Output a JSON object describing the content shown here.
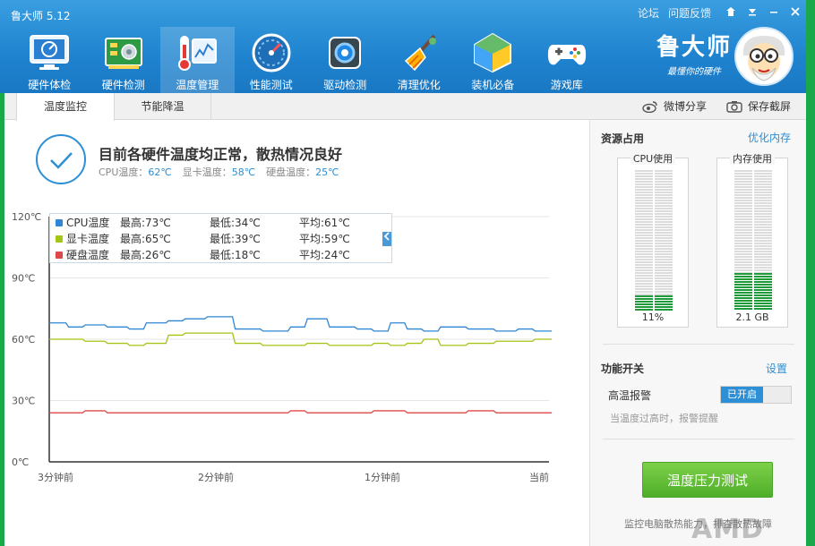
{
  "app": {
    "title": "鲁大师 5.12"
  },
  "window_controls": {
    "forum": "论坛",
    "feedback": "问题反馈"
  },
  "nav": [
    {
      "label": "硬件体检",
      "icon": "monitor-icon"
    },
    {
      "label": "硬件检测",
      "icon": "circuit-board-icon"
    },
    {
      "label": "温度管理",
      "icon": "thermometer-icon"
    },
    {
      "label": "性能测试",
      "icon": "speedometer-icon"
    },
    {
      "label": "驱动检测",
      "icon": "gear-chip-icon"
    },
    {
      "label": "清理优化",
      "icon": "broom-icon"
    },
    {
      "label": "装机必备",
      "icon": "cube-box-icon"
    },
    {
      "label": "游戏库",
      "icon": "gamepad-icon"
    }
  ],
  "active_nav": "温度管理",
  "brand": {
    "name": "鲁大师",
    "slogan": "最懂你的硬件"
  },
  "tabs": [
    {
      "label": "温度监控"
    },
    {
      "label": "节能降温"
    }
  ],
  "actions": {
    "weibo_share": "微博分享",
    "save_screenshot": "保存截屏"
  },
  "status": {
    "message": "目前各硬件温度均正常，散热情况良好",
    "cpu_label": "CPU温度：",
    "cpu_value": "62℃",
    "gpu_label": "显卡温度：",
    "gpu_value": "58℃",
    "disk_label": "硬盘温度：",
    "disk_value": "25℃"
  },
  "legend": [
    {
      "name": "CPU温度",
      "max": "最高:73℃",
      "min": "最低:34℃",
      "avg": "平均:61℃",
      "color": "#2f86d4"
    },
    {
      "name": "显卡温度",
      "max": "最高:65℃",
      "min": "最低:39℃",
      "avg": "平均:59℃",
      "color": "#a4c416"
    },
    {
      "name": "硬盘温度",
      "max": "最高:26℃",
      "min": "最低:18℃",
      "avg": "平均:24℃",
      "color": "#e04848"
    }
  ],
  "chart_data": {
    "type": "line",
    "x_tick_labels": [
      "3分钟前",
      "2分钟前",
      "1分钟前",
      "当前"
    ],
    "y_tick_labels": [
      "0℃",
      "30℃",
      "60℃",
      "90℃",
      "120℃"
    ],
    "ylim": [
      0,
      120
    ],
    "xlim": [
      -180,
      0
    ],
    "x": [
      -180,
      -174,
      -168,
      -160,
      -152,
      -146,
      -138,
      -132,
      -124,
      -114,
      -104,
      -94,
      -88,
      -80,
      -70,
      -64,
      -58,
      -52,
      -46,
      -40,
      -30,
      -20,
      -12,
      -6,
      0
    ],
    "series": [
      {
        "name": "CPU温度",
        "color": "#2f86d4",
        "values": [
          68,
          66,
          67,
          66,
          65,
          68,
          69,
          70,
          71,
          65,
          64,
          66,
          70,
          66,
          65,
          64,
          68,
          65,
          64,
          66,
          65,
          64,
          65,
          64,
          64
        ]
      },
      {
        "name": "显卡温度",
        "color": "#a4c416",
        "values": [
          60,
          60,
          59,
          58,
          57,
          58,
          62,
          63,
          63,
          58,
          57,
          57,
          58,
          57,
          57,
          58,
          57,
          58,
          60,
          57,
          58,
          59,
          59,
          60,
          60
        ]
      },
      {
        "name": "硬盘温度",
        "color": "#e04848",
        "values": [
          24,
          24,
          25,
          24,
          24,
          24,
          24,
          24,
          24,
          24,
          24,
          25,
          24,
          24,
          24,
          25,
          25,
          24,
          24,
          24,
          25,
          24,
          24,
          24,
          24
        ]
      }
    ],
    "grid": true
  },
  "side": {
    "resource_title": "资源占用",
    "optimize_memory": "优化内存",
    "cpu_label": "CPU使用",
    "cpu_value": "11%",
    "cpu_fraction": 0.11,
    "mem_label": "内存使用",
    "mem_value": "2.1 GB",
    "mem_fraction": 0.27,
    "function_title": "功能开关",
    "settings": "设置",
    "alarm_label": "高温报警",
    "alarm_state": "已开启",
    "alarm_desc": "当温度过高时，报警提醒",
    "stress_button": "温度压力测试",
    "footer": "监控电脑散热能力，排查散热故障"
  },
  "watermark": "AMD"
}
